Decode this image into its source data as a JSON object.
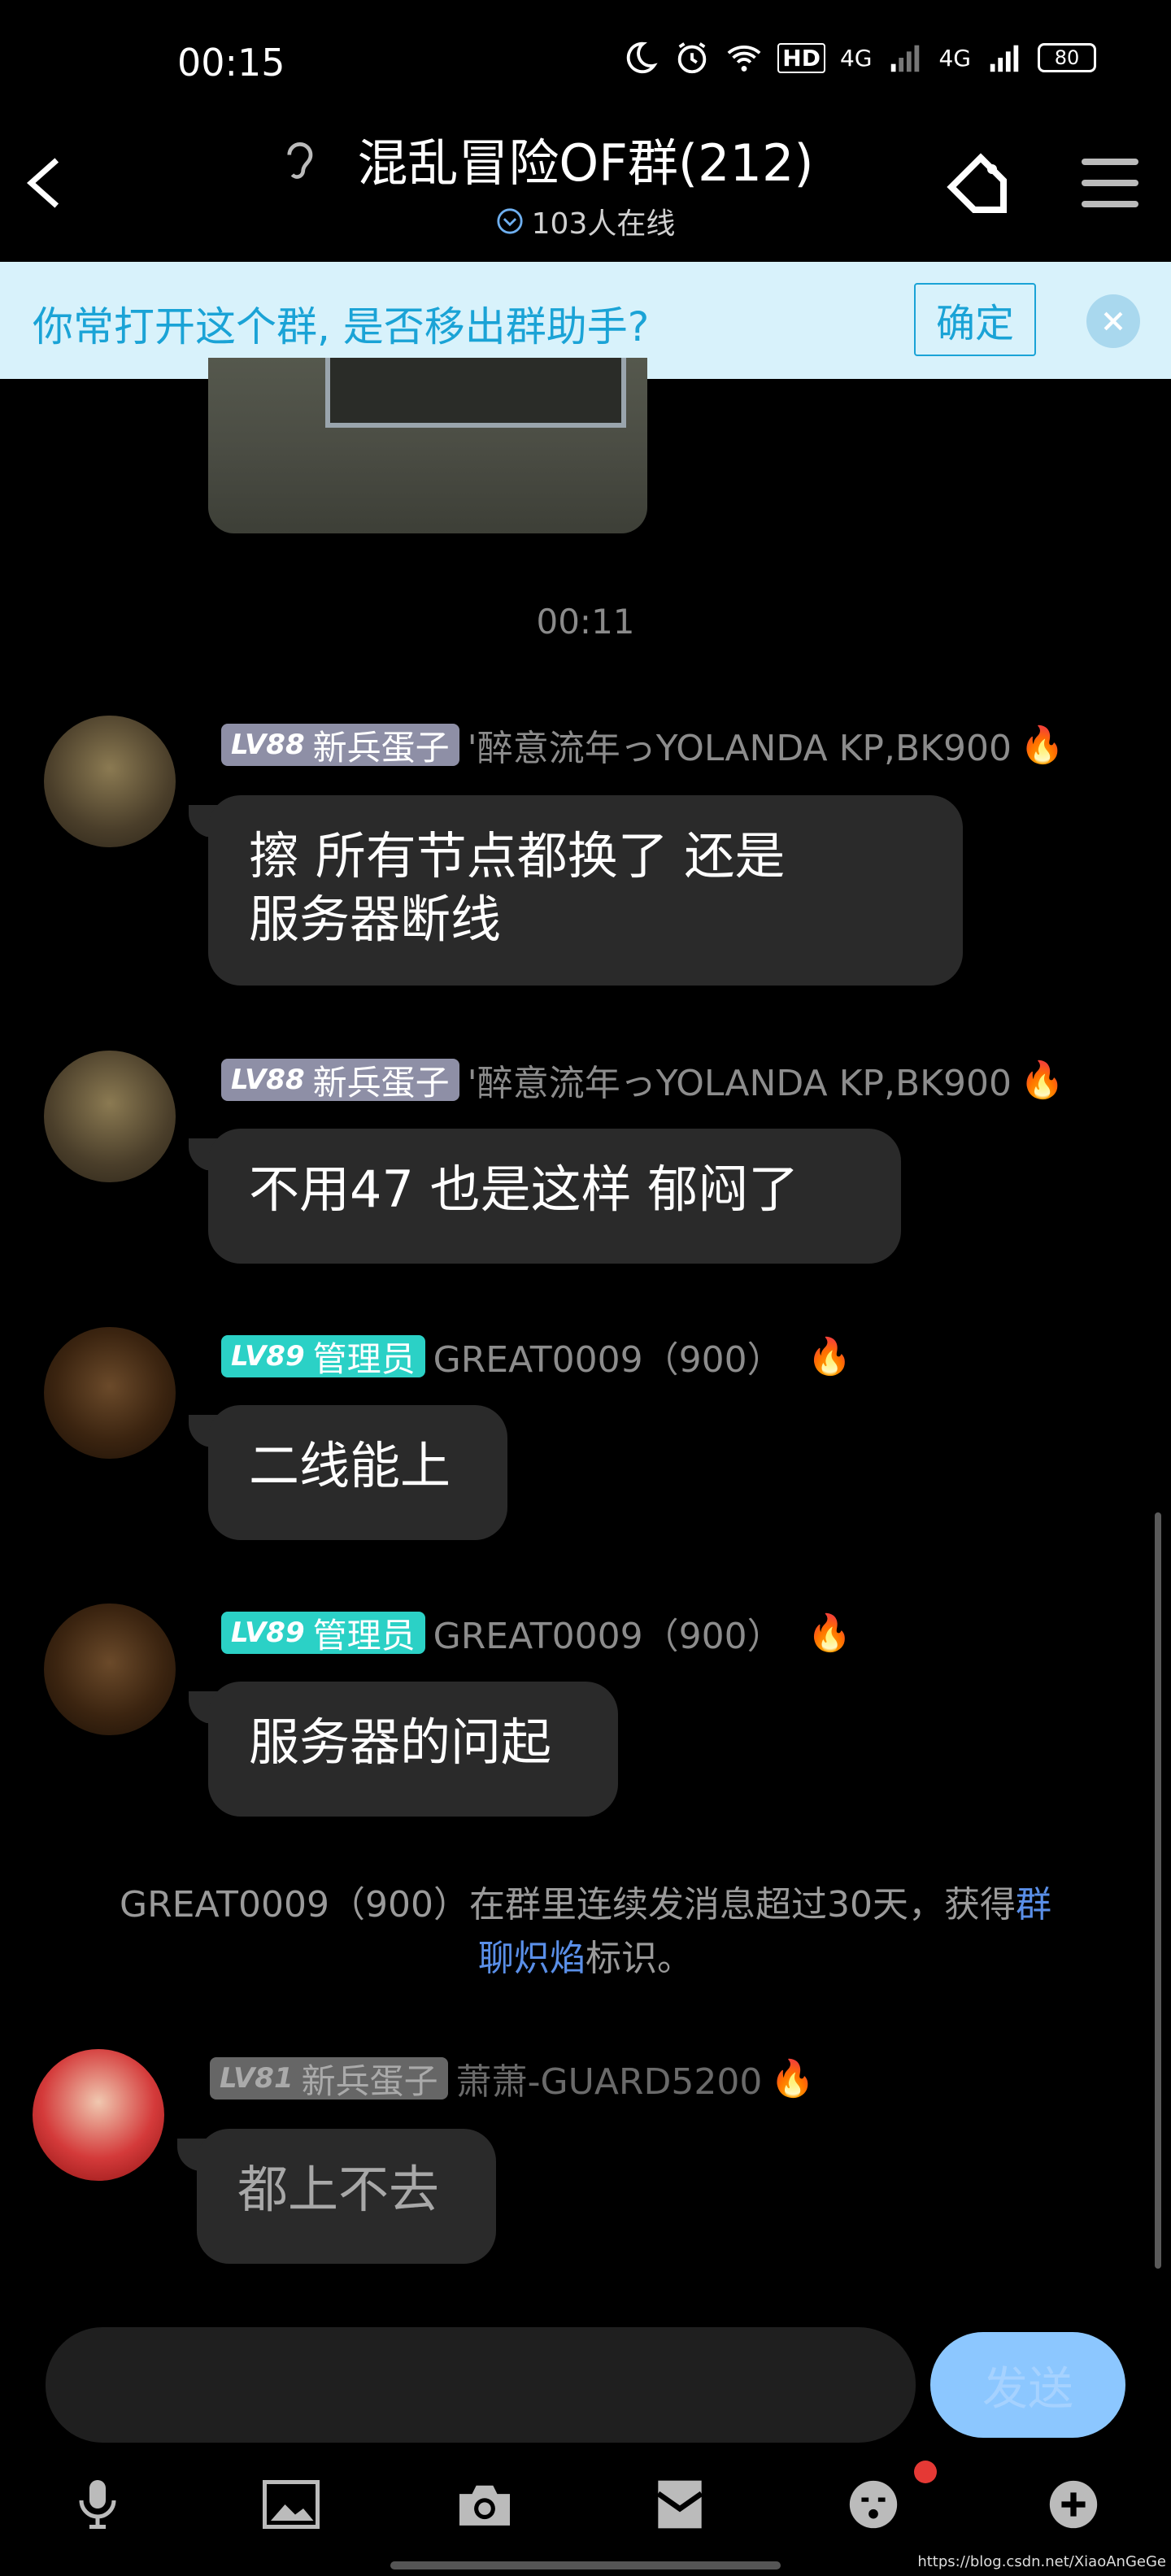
{
  "status_bar": {
    "time": "00:15",
    "hd_label": "HD",
    "net1": "4G",
    "net2": "4G",
    "battery": "80"
  },
  "header": {
    "title": "混乱冒险OF群(212)",
    "online": "103人在线"
  },
  "banner": {
    "text": "你常打开这个群, 是否移出群助手?",
    "confirm": "确定"
  },
  "timestamp": "00:11",
  "messages": [
    {
      "level": "LV88",
      "rank": "新兵蛋子",
      "name": "'醉意流年っYOLANDA  KP,BK900",
      "text_line1": "擦  所有节点都换了  还是",
      "text_line2": "服务器断线"
    },
    {
      "level": "LV88",
      "rank": "新兵蛋子",
      "name": "'醉意流年っYOLANDA  KP,BK900",
      "text": "不用47  也是这样  郁闷了"
    },
    {
      "level": "LV89",
      "rank": "管理员",
      "name": "GREAT0009（900）",
      "text": "二线能上"
    },
    {
      "level": "LV89",
      "rank": "管理员",
      "name": "GREAT0009（900）",
      "text": "服务器的问起"
    },
    {
      "level": "LV81",
      "rank": "新兵蛋子",
      "name": "萧萧-GUARD5200",
      "text": "都上不去"
    }
  ],
  "system_message": {
    "prefix": "GREAT0009（900）在群里连续发消息超过30天，获得",
    "link1": "群",
    "link2": "聊炽焰",
    "suffix": "标识。"
  },
  "input": {
    "value": "",
    "send_label": "发送"
  },
  "toolbar": {
    "icons": [
      "mic-icon",
      "image-icon",
      "camera-icon",
      "red-packet-icon",
      "emoji-icon",
      "plus-icon"
    ]
  },
  "watermark": "https://blog.csdn.net/XiaoAnGeGe",
  "colors": {
    "banner_bg": "#d8f2fb",
    "banner_accent": "#1aa3d6",
    "admin_badge": "#2bd1c6",
    "member_badge": "#8e8fa6",
    "send_button": "#8cc7ff",
    "link": "#5a8fe8"
  }
}
